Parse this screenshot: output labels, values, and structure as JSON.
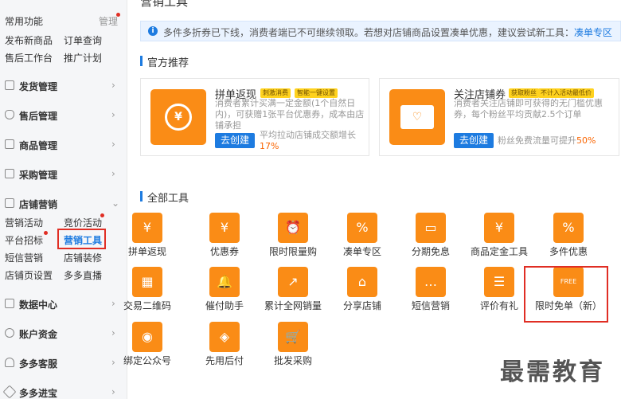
{
  "sidebar": {
    "header": "常用功能",
    "manage": "管理",
    "quick_links": [
      "发布新商品",
      "订单查询",
      "售后工作台",
      "推广计划"
    ],
    "groups": [
      {
        "label": "发货管理",
        "icon": "delivery-icon"
      },
      {
        "label": "售后管理",
        "icon": "shield-icon"
      },
      {
        "label": "商品管理",
        "icon": "product-icon"
      },
      {
        "label": "采购管理",
        "icon": "purchase-icon"
      },
      {
        "label": "店铺营销",
        "icon": "shop-icon"
      },
      {
        "label": "数据中心",
        "icon": "chart-icon"
      },
      {
        "label": "账户资金",
        "icon": "wallet-icon"
      },
      {
        "label": "多多客服",
        "icon": "headset-icon"
      },
      {
        "label": "多多进宝",
        "icon": "gem-icon"
      }
    ],
    "marketing_items": [
      "营销活动",
      "竞价活动",
      "平台招标",
      "营销工具",
      "短信营销",
      "店铺装修",
      "店铺页设置",
      "多多直播"
    ],
    "active_item": "营销工具"
  },
  "main": {
    "title": "营销工具",
    "notice": {
      "text": "多件多折券已下线，消费者端已不可继续领取。若想对店铺商品设置凑单优惠，建议尝试新工具：",
      "link": "凑单专区"
    },
    "recommend_title": "官方推荐",
    "recommend": [
      {
        "name": "拼单返现",
        "tags": [
          "刺激消费",
          "智能一键设置"
        ],
        "desc": "消费者累计买满一定金额(1个自然日内)，可获赠1张平台优惠券，成本由店铺承担",
        "button": "去创建",
        "stat": "平均拉动店铺成交额增长",
        "stat_pct": "17%"
      },
      {
        "name": "关注店铺券",
        "tags": [
          "获取粉丝",
          "不计入活动最低价"
        ],
        "desc": "消费者关注店铺即可获得的无门槛优惠券，每个粉丝平均贡献2.5个订单",
        "button": "去创建",
        "stat": "粉丝免费流量可提升",
        "stat_pct": "50%"
      }
    ],
    "all_tools_title": "全部工具",
    "tools": [
      {
        "label": "拼单返现",
        "icon": "yuan-coin-icon",
        "glyph": "¥"
      },
      {
        "label": "优惠券",
        "icon": "coupon-icon",
        "glyph": "¥"
      },
      {
        "label": "限时限量购",
        "icon": "alarm-clock-icon",
        "glyph": "⏰"
      },
      {
        "label": "凑单专区",
        "icon": "discount-envelope-icon",
        "glyph": "%"
      },
      {
        "label": "分期免息",
        "icon": "card-icon",
        "glyph": "▭"
      },
      {
        "label": "商品定金工具",
        "icon": "deposit-icon",
        "glyph": "¥"
      },
      {
        "label": "多件优惠",
        "icon": "multi-discount-icon",
        "glyph": "%"
      },
      {
        "label": "交易二维码",
        "icon": "qrcode-icon",
        "glyph": "▦"
      },
      {
        "label": "催付助手",
        "icon": "bell-icon",
        "glyph": "🔔"
      },
      {
        "label": "累计全网销量",
        "icon": "trend-chart-icon",
        "glyph": "↗"
      },
      {
        "label": "分享店铺",
        "icon": "share-shop-icon",
        "glyph": "⌂"
      },
      {
        "label": "短信营销",
        "icon": "message-icon",
        "glyph": "…"
      },
      {
        "label": "评价有礼",
        "icon": "review-icon",
        "glyph": "☰"
      },
      {
        "label": "限时免单（新）",
        "icon": "free-order-icon",
        "glyph": "FREE"
      },
      {
        "label": "绑定公众号",
        "icon": "wechat-icon",
        "glyph": "◉"
      },
      {
        "label": "先用后付",
        "icon": "pay-later-icon",
        "glyph": "◈"
      },
      {
        "label": "批发采购",
        "icon": "cart-icon",
        "glyph": "🛒"
      }
    ]
  },
  "watermark": "最需教育",
  "colors": {
    "accent": "#1d7be0",
    "tool_orange": "#fa8c16",
    "highlight": "#e02e24"
  }
}
